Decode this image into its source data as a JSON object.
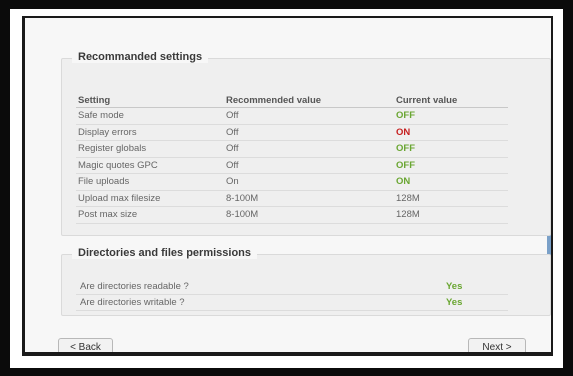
{
  "recommended": {
    "title": "Recommanded settings",
    "headers": {
      "setting": "Setting",
      "recommended": "Recommended value",
      "current": "Current value"
    },
    "rows": [
      {
        "setting": "Safe mode",
        "recommended": "Off",
        "current": "OFF",
        "status": "off"
      },
      {
        "setting": "Display errors",
        "recommended": "Off",
        "current": "ON",
        "status": "on"
      },
      {
        "setting": "Register globals",
        "recommended": "Off",
        "current": "OFF",
        "status": "off"
      },
      {
        "setting": "Magic quotes GPC",
        "recommended": "Off",
        "current": "OFF",
        "status": "off"
      },
      {
        "setting": "File uploads",
        "recommended": "On",
        "current": "ON",
        "status": "off"
      },
      {
        "setting": "Upload max filesize",
        "recommended": "8-100M",
        "current": "128M",
        "status": "plain"
      },
      {
        "setting": "Post max size",
        "recommended": "8-100M",
        "current": "128M",
        "status": "plain"
      }
    ]
  },
  "permissions": {
    "title": "Directories and files permissions",
    "rows": [
      {
        "label": "Are directories readable ?",
        "value": "Yes"
      },
      {
        "label": "Are directories writable ?",
        "value": "Yes"
      }
    ]
  },
  "buttons": {
    "back": "< Back",
    "next": "Next >"
  },
  "colors": {
    "ok": "#6aa632",
    "bad": "#c61f1f"
  }
}
